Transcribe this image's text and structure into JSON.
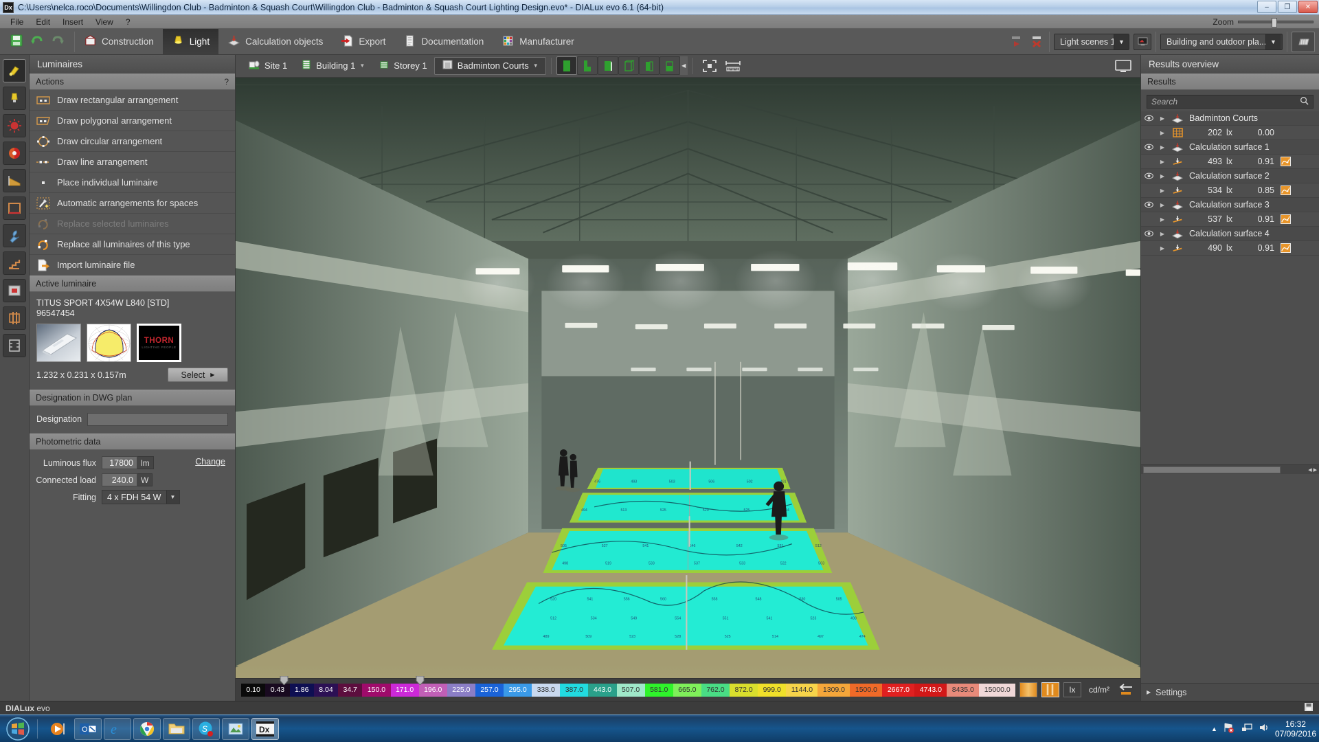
{
  "window": {
    "title": "C:\\Users\\nelca.roco\\Documents\\Willingdon Club - Badminton & Squash Court\\Willingdon Club - Badminton & Squash Court Lighting Design.evo* - DIALux evo 6.1  (64-bit)",
    "app_icon_label": "Dx",
    "minimize": "–",
    "maximize": "❐",
    "close": "✕"
  },
  "menu": {
    "items": [
      "File",
      "Edit",
      "Insert",
      "View",
      "?"
    ],
    "zoom_label": "Zoom"
  },
  "toolbar": {
    "save": "save-icon",
    "undo": "undo-icon",
    "redo": "redo-icon",
    "tabs": [
      {
        "label": "Construction",
        "icon": "construction-icon",
        "active": false
      },
      {
        "label": "Light",
        "icon": "light-icon",
        "active": true
      },
      {
        "label": "Calculation objects",
        "icon": "calculation-objects-icon",
        "active": false
      },
      {
        "label": "Export",
        "icon": "export-icon",
        "active": false
      },
      {
        "label": "Documentation",
        "icon": "documentation-icon",
        "active": false
      },
      {
        "label": "Manufacturer",
        "icon": "manufacturer-icon",
        "active": false
      }
    ],
    "light_scene": "Light scenes 1",
    "view_mode": "Building and outdoor pla..."
  },
  "left_panel": {
    "title": "Luminaires",
    "actions_header": "Actions",
    "help_glyph": "?",
    "actions": [
      {
        "label": "Draw rectangular arrangement",
        "icon": "rectangular-arrangement-icon",
        "disabled": false
      },
      {
        "label": "Draw polygonal arrangement",
        "icon": "polygonal-arrangement-icon",
        "disabled": false
      },
      {
        "label": "Draw circular arrangement",
        "icon": "circular-arrangement-icon",
        "disabled": false
      },
      {
        "label": "Draw line arrangement",
        "icon": "line-arrangement-icon",
        "disabled": false
      },
      {
        "label": "Place individual luminaire",
        "icon": "single-luminaire-icon",
        "disabled": false
      },
      {
        "label": "Automatic arrangements for spaces",
        "icon": "magic-wand-icon",
        "disabled": false
      },
      {
        "label": "Replace selected luminaires",
        "icon": "replace-selected-icon",
        "disabled": true
      },
      {
        "label": "Replace all luminaires of this type",
        "icon": "replace-all-icon",
        "disabled": false
      },
      {
        "label": "Import luminaire file",
        "icon": "import-file-icon",
        "disabled": false
      }
    ],
    "active_luminaire_header": "Active luminaire",
    "luminaire_name": "TITUS SPORT 4X54W L840 [STD]",
    "luminaire_code": "96547454",
    "brand": "THORN",
    "brand_tagline": "LIGHTING PEOPLE",
    "dimensions": "1.232 x 0.231 x 0.157m",
    "select_button": "Select",
    "designation_header": "Designation in DWG plan",
    "designation_label": "Designation",
    "designation_value": "",
    "photometric_header": "Photometric data",
    "luminous_flux_label": "Luminous flux",
    "luminous_flux_value": "17800",
    "luminous_flux_unit": "lm",
    "connected_load_label": "Connected load",
    "connected_load_value": "240.0",
    "connected_load_unit": "W",
    "fitting_label": "Fitting",
    "fitting_value": "4 x FDH 54 W",
    "change_link": "Change"
  },
  "viewport": {
    "breadcrumbs": [
      {
        "label": "Site 1",
        "icon": "site-icon",
        "has_arrow": false,
        "boxed": false
      },
      {
        "label": "Building 1",
        "icon": "building-icon",
        "has_arrow": true,
        "boxed": false
      },
      {
        "label": "Storey 1",
        "icon": "storey-icon",
        "has_arrow": false,
        "boxed": false
      },
      {
        "label": "Badminton Courts",
        "icon": "room-icon",
        "has_arrow": true,
        "boxed": true
      }
    ],
    "view_buttons": [
      "solid-view-icon",
      "section-view-icon",
      "front-view-icon",
      "wireframe-view-icon",
      "side-view-icon",
      "perspective-view-icon"
    ],
    "collapse_icon": "collapse-left-icon",
    "fullscreen_icon": "fullscreen-icon",
    "measure_icon": "measure-icon",
    "monitor_icon": "monitor-icon"
  },
  "scale": {
    "values": [
      "0.10",
      "0.43",
      "1.86",
      "8.04",
      "34.7",
      "150.0",
      "171.0",
      "196.0",
      "225.0",
      "257.0",
      "295.0",
      "338.0",
      "387.0",
      "443.0",
      "507.0",
      "581.0",
      "665.0",
      "762.0",
      "872.0",
      "999.0",
      "1144.0",
      "1309.0",
      "1500.0",
      "2667.0",
      "4743.0",
      "8435.0",
      "15000.0"
    ],
    "colors": [
      "#0a0a0a",
      "#190a20",
      "#0e0f52",
      "#2c1054",
      "#5c0e3e",
      "#9f0b6b",
      "#cc29d8",
      "#c15fb6",
      "#8b7ec6",
      "#1a63d8",
      "#3a9ae8",
      "#c9d9ef",
      "#22dbe0",
      "#2aa08a",
      "#9fe8c9",
      "#2ff32b",
      "#7ff05a",
      "#49dd85",
      "#d9df2d",
      "#f0e02a",
      "#f7d44a",
      "#f5a63a",
      "#f06a28",
      "#e02020",
      "#d21818",
      "#e88a7a",
      "#f0d8d8"
    ],
    "text_colors": [
      "#ffffff",
      "#ffffff",
      "#ffffff",
      "#ffffff",
      "#ffffff",
      "#ffffff",
      "#ffffff",
      "#ffffff",
      "#ffffff",
      "#ffffff",
      "#ffffff",
      "#333333",
      "#333333",
      "#ffffff",
      "#333333",
      "#333333",
      "#333333",
      "#333333",
      "#333333",
      "#333333",
      "#333333",
      "#333333",
      "#333333",
      "#ffffff",
      "#ffffff",
      "#333333",
      "#333333"
    ],
    "marker_positions": [
      5,
      22.5
    ],
    "unit_lx": "lx",
    "unit_cdm2": "cd/m²",
    "false_color_icon": "false-color-icon",
    "iso_lines_icon": "iso-lines-icon",
    "swap_icon": "swap-icon"
  },
  "results": {
    "overview_title": "Results overview",
    "results_title": "Results",
    "search_placeholder": "Search",
    "search_icon": "search-icon",
    "rows": [
      {
        "type": "group",
        "eye": true,
        "arrow": true,
        "icon": "calc-surface-icon",
        "label": "Badminton Courts"
      },
      {
        "type": "value",
        "eye": false,
        "arrow": true,
        "icon": "grid-icon",
        "value": "202",
        "unit": "lx",
        "value2": "0.00",
        "chip": false
      },
      {
        "type": "group",
        "eye": true,
        "arrow": true,
        "icon": "calc-surface-icon",
        "label": "Calculation surface 1"
      },
      {
        "type": "value",
        "eye": false,
        "arrow": true,
        "icon": "workplane-icon",
        "value": "493",
        "unit": "lx",
        "value2": "0.91",
        "chip": true
      },
      {
        "type": "group",
        "eye": true,
        "arrow": true,
        "icon": "calc-surface-icon",
        "label": "Calculation surface 2"
      },
      {
        "type": "value",
        "eye": false,
        "arrow": true,
        "icon": "workplane-icon",
        "value": "534",
        "unit": "lx",
        "value2": "0.85",
        "chip": true
      },
      {
        "type": "group",
        "eye": true,
        "arrow": true,
        "icon": "calc-surface-icon",
        "label": "Calculation surface 3"
      },
      {
        "type": "value",
        "eye": false,
        "arrow": true,
        "icon": "workplane-icon",
        "value": "537",
        "unit": "lx",
        "value2": "0.91",
        "chip": true
      },
      {
        "type": "group",
        "eye": true,
        "arrow": true,
        "icon": "calc-surface-icon",
        "label": "Calculation surface 4"
      },
      {
        "type": "value",
        "eye": false,
        "arrow": true,
        "icon": "workplane-icon",
        "value": "490",
        "unit": "lx",
        "value2": "0.91",
        "chip": true
      }
    ],
    "settings_label": "Settings"
  },
  "statusbar": {
    "app_name_bold": "DIALux",
    "app_name_rest": " evo"
  },
  "taskbar": {
    "start": "start-orb-icon",
    "items": [
      {
        "icon": "media-player-icon",
        "active": false
      },
      {
        "icon": "outlook-icon",
        "active": false
      },
      {
        "icon": "internet-explorer-icon",
        "active": false
      },
      {
        "icon": "chrome-icon",
        "active": false
      },
      {
        "icon": "file-explorer-icon",
        "active": false
      },
      {
        "icon": "skype-icon",
        "active": false
      },
      {
        "icon": "photo-viewer-icon",
        "active": false
      },
      {
        "icon": "dialux-icon",
        "active": true,
        "label": "Dx"
      }
    ],
    "tray_icons": [
      "show-hidden-icons",
      "network-error-icon",
      "network-icon",
      "volume-icon"
    ],
    "time": "16:32",
    "date": "07/09/2016"
  }
}
